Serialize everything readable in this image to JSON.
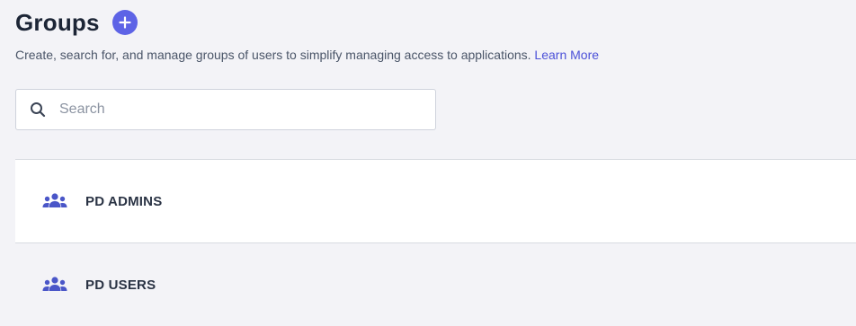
{
  "header": {
    "title": "Groups"
  },
  "description": {
    "text": "Create, search for, and manage groups of users to simplify managing access to applications.",
    "link_label": "Learn More"
  },
  "search": {
    "placeholder": "Search",
    "value": ""
  },
  "groups": [
    {
      "name": "PD ADMINS",
      "icon": "users-icon"
    },
    {
      "name": "PD USERS",
      "icon": "users-icon"
    }
  ],
  "colors": {
    "accent": "#5d63e6",
    "link": "#4c51d8",
    "group_icon": "#4a56c8"
  }
}
